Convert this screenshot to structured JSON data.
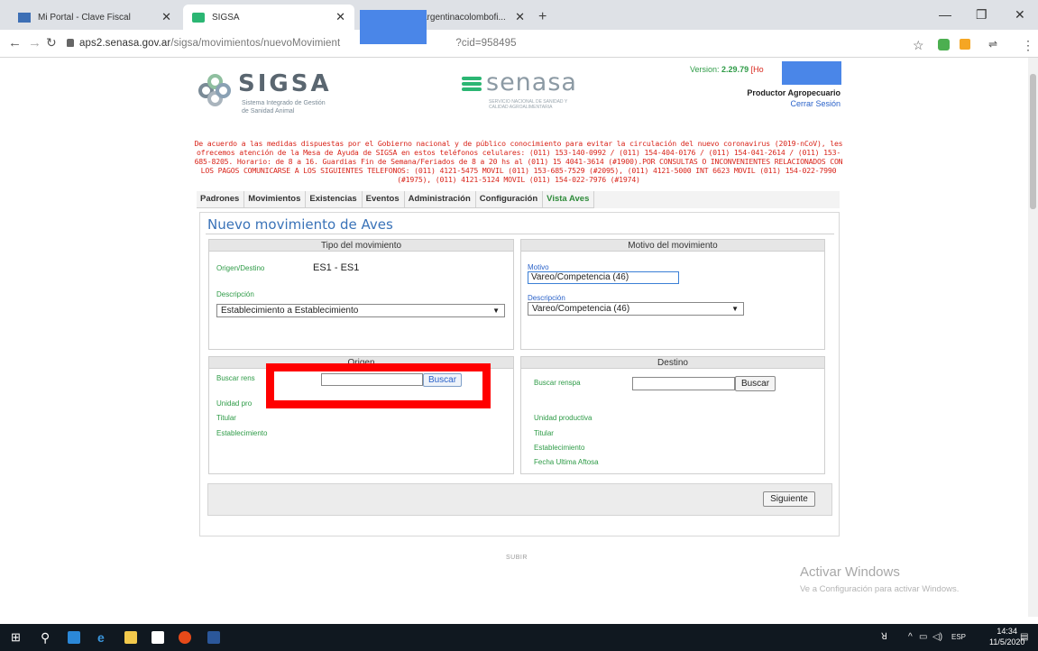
{
  "browser": {
    "tabs": [
      {
        "title": "Mi Portal - Clave Fiscal",
        "active": false
      },
      {
        "title": "SIGSA",
        "active": true
      },
      {
        "title": "argentinacolombofi...",
        "active": false
      }
    ],
    "url_domain": "aps2.senasa.gov.ar",
    "url_path_start": "/sigsa/movimientos/nuevoMovimient",
    "url_path_end": "?cid=958495"
  },
  "header": {
    "sigsa_title": "SIGSA",
    "sigsa_subtitle": "Sistema Integrado de Gestión de Sanidad Animal",
    "senasa_title": "senasa",
    "senasa_subtitle": "SERVICIO NACIONAL DE SANIDAD Y CALIDAD AGROALIMENTARIA",
    "version_label": "Version:",
    "version_number": "2.29.79",
    "version_extra": "[Ho",
    "role": "Productor Agropecuario",
    "logout": "Cerrar Sesión"
  },
  "notice": "De acuerdo a las medidas dispuestas por el Gobierno nacional y de público conocimiento para evitar la circulación del nuevo coronavirus (2019-nCoV), les ofrecemos atención de la Mesa de Ayuda de SIGSA en estos teléfonos celulares: (011) 153-140-0992 / (011) 154-404-0176 / (011) 154-041-2614 / (011) 153-685-8205. Horario: de 8 a 16. Guardias Fin de Semana/Feriados de 8 a 20 hs al (011) 15 4041-3614 (#1900).POR CONSULTAS O INCONVENIENTES RELACIONADOS CON LOS PAGOS COMUNICARSE A LOS SIGUIENTES TELEFONOS: (011) 4121-5475 MOVIL (011) 153-685-7529 (#2095), (011) 4121-5000 INT 6623 MOVIL (011) 154-022-7990 (#1975), (011) 4121-5124 MOVIL (011) 154-022-7976 (#1974)",
  "menu": [
    "Padrones",
    "Movimientos",
    "Existencias",
    "Eventos",
    "Administración",
    "Configuración",
    "Vista Aves"
  ],
  "form": {
    "title": "Nuevo movimiento de Aves",
    "tipo": {
      "header": "Tipo del movimiento",
      "origen_destino_label": "Origen/Destino",
      "origen_destino_value": "ES1 - ES1",
      "descripcion_label": "Descripción",
      "descripcion_value": "Establecimiento a Establecimiento"
    },
    "motivo": {
      "header": "Motivo del movimiento",
      "motivo_label": "Motivo",
      "motivo_value": "Vareo/Competencia (46)",
      "descripcion_label": "Descripción",
      "descripcion_value": "Vareo/Competencia (46)"
    },
    "origen": {
      "header": "Origen",
      "buscar_label": "Buscar rens",
      "buscar_button": "Buscar",
      "unidad": "Unidad pro",
      "titular": "Titular",
      "establecimiento": "Establecimiento"
    },
    "destino": {
      "header": "Destino",
      "buscar_label": "Buscar renspa",
      "buscar_button": "Buscar",
      "unidad": "Unidad productiva",
      "titular": "Titular",
      "establecimiento": "Establecimiento",
      "fecha": "Fecha Ultima Aftosa"
    },
    "siguiente": "Siguiente"
  },
  "footer_link": "SUBIR",
  "activation": {
    "title": "Activar Windows",
    "subtitle": "Ve a Configuración para activar Windows."
  },
  "taskbar": {
    "lang": "ESP",
    "time": "14:34",
    "date": "11/5/2020"
  }
}
